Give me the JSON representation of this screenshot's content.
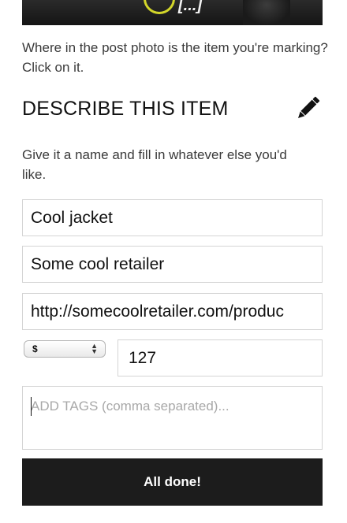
{
  "photo": {
    "ellipsis_text": "[...]"
  },
  "instructions": "Where in the post photo is the item you're marking? Click on it.",
  "section": {
    "title": "DESCRIBE THIS ITEM",
    "icon": "pencil-icon",
    "helper": "Give it a name and fill in whatever else you'd like."
  },
  "form": {
    "name_value": "Cool jacket",
    "retailer_value": "Some cool retailer",
    "url_value": "http://somecoolretailer.com/produc",
    "currency_selected": "$",
    "price_value": "127",
    "tags_placeholder": "ADD TAGS (comma separated)..."
  },
  "actions": {
    "done_label": "All done!"
  },
  "colors": {
    "button_bg": "#1c1c1c",
    "ring": "#d3d62a"
  }
}
